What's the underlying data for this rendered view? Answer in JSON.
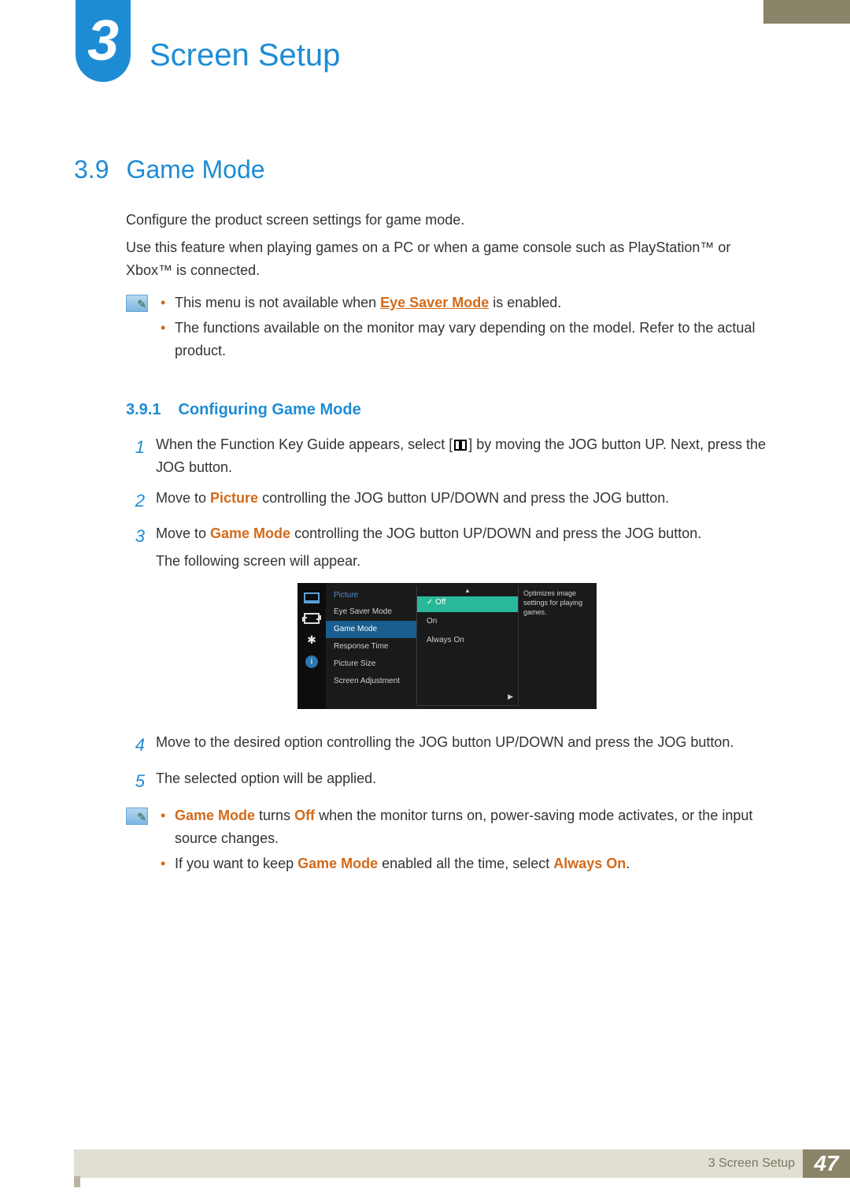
{
  "chapter": {
    "number": "3",
    "title": "Screen Setup"
  },
  "section": {
    "number": "3.9",
    "title": "Game Mode"
  },
  "intro": {
    "p1": "Configure the product screen settings for game mode.",
    "p2": "Use this feature when playing games on a PC or when a game console such as PlayStation™ or Xbox™ is connected."
  },
  "note1": {
    "b1_pre": "This menu is not available when ",
    "b1_link": "Eye Saver Mode",
    "b1_post": " is enabled.",
    "b2": "The functions available on the monitor may vary depending on the model. Refer to the actual product."
  },
  "subsection": {
    "number": "3.9.1",
    "title": "Configuring Game Mode"
  },
  "steps": {
    "s1a": "When the Function Key Guide appears, select [",
    "s1b": "] by moving the JOG button UP. Next, press the JOG button.",
    "s2_pre": "Move to ",
    "s2_kw": "Picture",
    "s2_post": " controlling the JOG button UP/DOWN and press the JOG button.",
    "s3_pre": "Move to ",
    "s3_kw": "Game Mode",
    "s3_post": " controlling the JOG button UP/DOWN and press the JOG button.",
    "s3_extra": "The following screen will appear.",
    "s4": "Move to the desired option controlling the JOG button UP/DOWN and press the JOG button.",
    "s5": "The selected option will be applied."
  },
  "step_nums": {
    "n1": "1",
    "n2": "2",
    "n3": "3",
    "n4": "4",
    "n5": "5"
  },
  "osd": {
    "menu_title": "Picture",
    "items": {
      "eye": "Eye Saver Mode",
      "game": "Game Mode",
      "resp": "Response Time",
      "size": "Picture Size",
      "scr": "Screen Adjustment"
    },
    "options": {
      "off": "Off",
      "on": "On",
      "always": "Always On"
    },
    "tooltip": "Optimizes image settings for playing games."
  },
  "note2": {
    "b1_kw1": "Game Mode",
    "b1_mid": " turns ",
    "b1_kw2": "Off",
    "b1_post": " when the monitor turns on, power-saving mode activates, or the input source changes.",
    "b2_pre": "If you want to keep ",
    "b2_kw1": "Game Mode",
    "b2_mid": " enabled all the time, select ",
    "b2_kw2": "Always On",
    "b2_post": "."
  },
  "footer": {
    "text": "3 Screen Setup",
    "page": "47"
  }
}
